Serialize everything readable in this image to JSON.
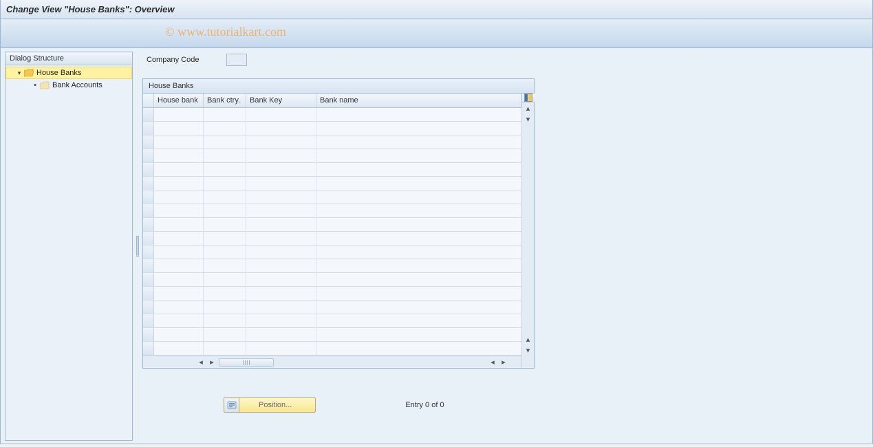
{
  "title": "Change View \"House Banks\": Overview",
  "watermark": "© www.tutorialkart.com",
  "sidebar": {
    "header": "Dialog Structure",
    "items": [
      {
        "label": "House Banks",
        "selected": true,
        "iconColor": "#f2c94c",
        "open": true
      },
      {
        "label": "Bank Accounts",
        "selected": false,
        "iconColor": "#f2e6b0"
      }
    ]
  },
  "form": {
    "company_code_label": "Company Code",
    "company_code_value": ""
  },
  "table": {
    "title": "House Banks",
    "columns": [
      "House bank",
      "Bank ctry.",
      "Bank Key",
      "Bank name"
    ],
    "row_count": 18
  },
  "footer": {
    "position_label": "Position...",
    "entry_text": "Entry 0 of 0"
  }
}
